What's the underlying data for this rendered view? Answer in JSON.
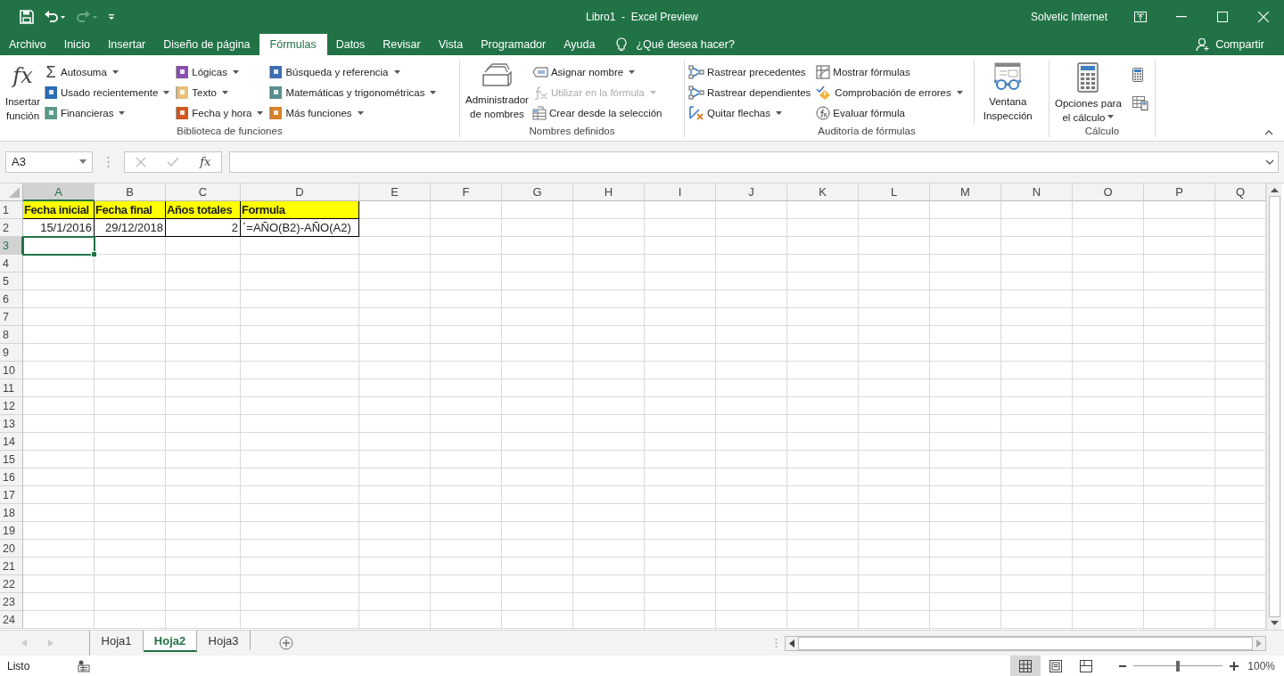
{
  "window": {
    "title": "Libro1  -  Excel Preview",
    "user": "Solvetic Internet"
  },
  "tabs": [
    {
      "label": "Archivo",
      "selected": false
    },
    {
      "label": "Inicio",
      "selected": false
    },
    {
      "label": "Insertar",
      "selected": false
    },
    {
      "label": "Diseño de página",
      "selected": false
    },
    {
      "label": "Fórmulas",
      "selected": true
    },
    {
      "label": "Datos",
      "selected": false
    },
    {
      "label": "Revisar",
      "selected": false
    },
    {
      "label": "Vista",
      "selected": false
    },
    {
      "label": "Programador",
      "selected": false
    },
    {
      "label": "Ayuda",
      "selected": false
    }
  ],
  "tell_me": {
    "placeholder": "¿Qué desea hacer?"
  },
  "share": {
    "label": "Compartir"
  },
  "ribbon": [
    {
      "name": "Biblioteca de funciones",
      "columns": [
        {
          "kind": "large",
          "icon_text": "fx",
          "lines": [
            "Insertar",
            "función"
          ],
          "dropdown": false
        },
        {
          "kind": "small",
          "items": [
            {
              "icon_text": "Σ",
              "label": "Autosuma",
              "dropdown": true,
              "disabled": false
            },
            {
              "label": "Usado recientemente",
              "dropdown": true,
              "disabled": false
            },
            {
              "label": "Financieras",
              "dropdown": true,
              "disabled": false
            }
          ]
        },
        {
          "kind": "small",
          "items": [
            {
              "label": "Lógicas",
              "dropdown": true,
              "disabled": false
            },
            {
              "label": "Texto",
              "dropdown": true,
              "disabled": false
            },
            {
              "label": "Fecha y hora",
              "dropdown": true,
              "disabled": false
            }
          ]
        },
        {
          "kind": "small",
          "items": [
            {
              "label": "Búsqueda y referencia",
              "dropdown": true,
              "disabled": false
            },
            {
              "label": "Matemáticas y trigonométricas",
              "dropdown": true,
              "disabled": false
            },
            {
              "label": "Más funciones",
              "dropdown": true,
              "disabled": false
            }
          ]
        }
      ]
    },
    {
      "name": "Nombres definidos",
      "columns": [
        {
          "kind": "large",
          "lines": [
            "Administrador",
            "de nombres"
          ],
          "dropdown": false
        },
        {
          "kind": "small",
          "items": [
            {
              "label": "Asignar nombre",
              "dropdown": true,
              "disabled": false
            },
            {
              "label": "Utilizar en la fórmula",
              "dropdown": true,
              "disabled": true
            },
            {
              "label": "Crear desde la selección",
              "dropdown": false,
              "disabled": false
            }
          ]
        }
      ]
    },
    {
      "name": "Auditoría de fórmulas",
      "columns": [
        {
          "kind": "small",
          "items": [
            {
              "label": "Rastrear precedentes",
              "dropdown": false,
              "disabled": false
            },
            {
              "label": "Rastrear dependientes",
              "dropdown": false,
              "disabled": false
            },
            {
              "label": "Quitar flechas",
              "dropdown": true,
              "disabled": false
            }
          ]
        },
        {
          "kind": "small",
          "items": [
            {
              "label": "Mostrar fórmulas",
              "dropdown": false,
              "disabled": false
            },
            {
              "label": "Comprobación de errores",
              "dropdown": true,
              "disabled": false
            },
            {
              "label": "Evaluar fórmula",
              "dropdown": false,
              "disabled": false
            }
          ]
        },
        {
          "kind": "large",
          "lines": [
            "Ventana",
            "Inspección"
          ],
          "dropdown": false
        }
      ]
    },
    {
      "name": "Cálculo",
      "columns": [
        {
          "kind": "large",
          "lines": [
            "Opciones para",
            "el cálculo"
          ],
          "dropdown": true
        },
        {
          "kind": "icons"
        }
      ]
    }
  ],
  "formula_bar": {
    "name_box": "A3",
    "fx": "fx"
  },
  "grid": {
    "columns": [
      {
        "label": "A",
        "selected": true
      },
      {
        "label": "B",
        "selected": false
      },
      {
        "label": "C",
        "selected": false
      },
      {
        "label": "D",
        "selected": false
      },
      {
        "label": "E",
        "selected": false
      },
      {
        "label": "F",
        "selected": false
      },
      {
        "label": "G",
        "selected": false
      },
      {
        "label": "H",
        "selected": false
      },
      {
        "label": "I",
        "selected": false
      },
      {
        "label": "J",
        "selected": false
      },
      {
        "label": "K",
        "selected": false
      },
      {
        "label": "L",
        "selected": false
      },
      {
        "label": "M",
        "selected": false
      },
      {
        "label": "N",
        "selected": false
      },
      {
        "label": "O",
        "selected": false
      },
      {
        "label": "P",
        "selected": false
      },
      {
        "label": "Q",
        "selected": false
      }
    ],
    "rows": [
      {
        "header": "1",
        "selected": false,
        "cells": [
          {
            "text": "Fecha inicial",
            "kind": "label"
          },
          {
            "text": "Fecha final",
            "kind": "label"
          },
          {
            "text": "Años totales",
            "kind": "label"
          },
          {
            "text": "Formula",
            "kind": "label"
          }
        ]
      },
      {
        "header": "2",
        "selected": false,
        "cells": [
          {
            "text": "15/1/2016",
            "kind": "number"
          },
          {
            "text": "29/12/2018",
            "kind": "number"
          },
          {
            "text": "2",
            "kind": "number"
          },
          {
            "text": "´=AÑO(B2)-AÑO(A2)",
            "kind": "text"
          }
        ]
      },
      {
        "header": "3",
        "selected": true,
        "cells": []
      },
      {
        "header": "4",
        "selected": false,
        "cells": []
      },
      {
        "header": "5",
        "selected": false,
        "cells": []
      },
      {
        "header": "6",
        "selected": false,
        "cells": []
      },
      {
        "header": "7",
        "selected": false,
        "cells": []
      },
      {
        "header": "8",
        "selected": false,
        "cells": []
      },
      {
        "header": "9",
        "selected": false,
        "cells": []
      },
      {
        "header": "10",
        "selected": false,
        "cells": []
      },
      {
        "header": "11",
        "selected": false,
        "cells": []
      },
      {
        "header": "12",
        "selected": false,
        "cells": []
      },
      {
        "header": "13",
        "selected": false,
        "cells": []
      },
      {
        "header": "14",
        "selected": false,
        "cells": []
      },
      {
        "header": "15",
        "selected": false,
        "cells": []
      },
      {
        "header": "16",
        "selected": false,
        "cells": []
      },
      {
        "header": "17",
        "selected": false,
        "cells": []
      },
      {
        "header": "18",
        "selected": false,
        "cells": []
      },
      {
        "header": "19",
        "selected": false,
        "cells": []
      },
      {
        "header": "20",
        "selected": false,
        "cells": []
      },
      {
        "header": "21",
        "selected": false,
        "cells": []
      },
      {
        "header": "22",
        "selected": false,
        "cells": []
      },
      {
        "header": "23",
        "selected": false,
        "cells": []
      },
      {
        "header": "24",
        "selected": false,
        "cells": []
      }
    ]
  },
  "sheets": [
    {
      "label": "Hoja1",
      "selected": false
    },
    {
      "label": "Hoja2",
      "selected": true
    },
    {
      "label": "Hoja3",
      "selected": false
    }
  ],
  "status_bar": {
    "text": "Listo",
    "views": [
      {
        "selected": true
      },
      {
        "selected": false
      },
      {
        "selected": false
      }
    ],
    "zoom": {
      "level": 0.5,
      "reading": "100%"
    }
  }
}
